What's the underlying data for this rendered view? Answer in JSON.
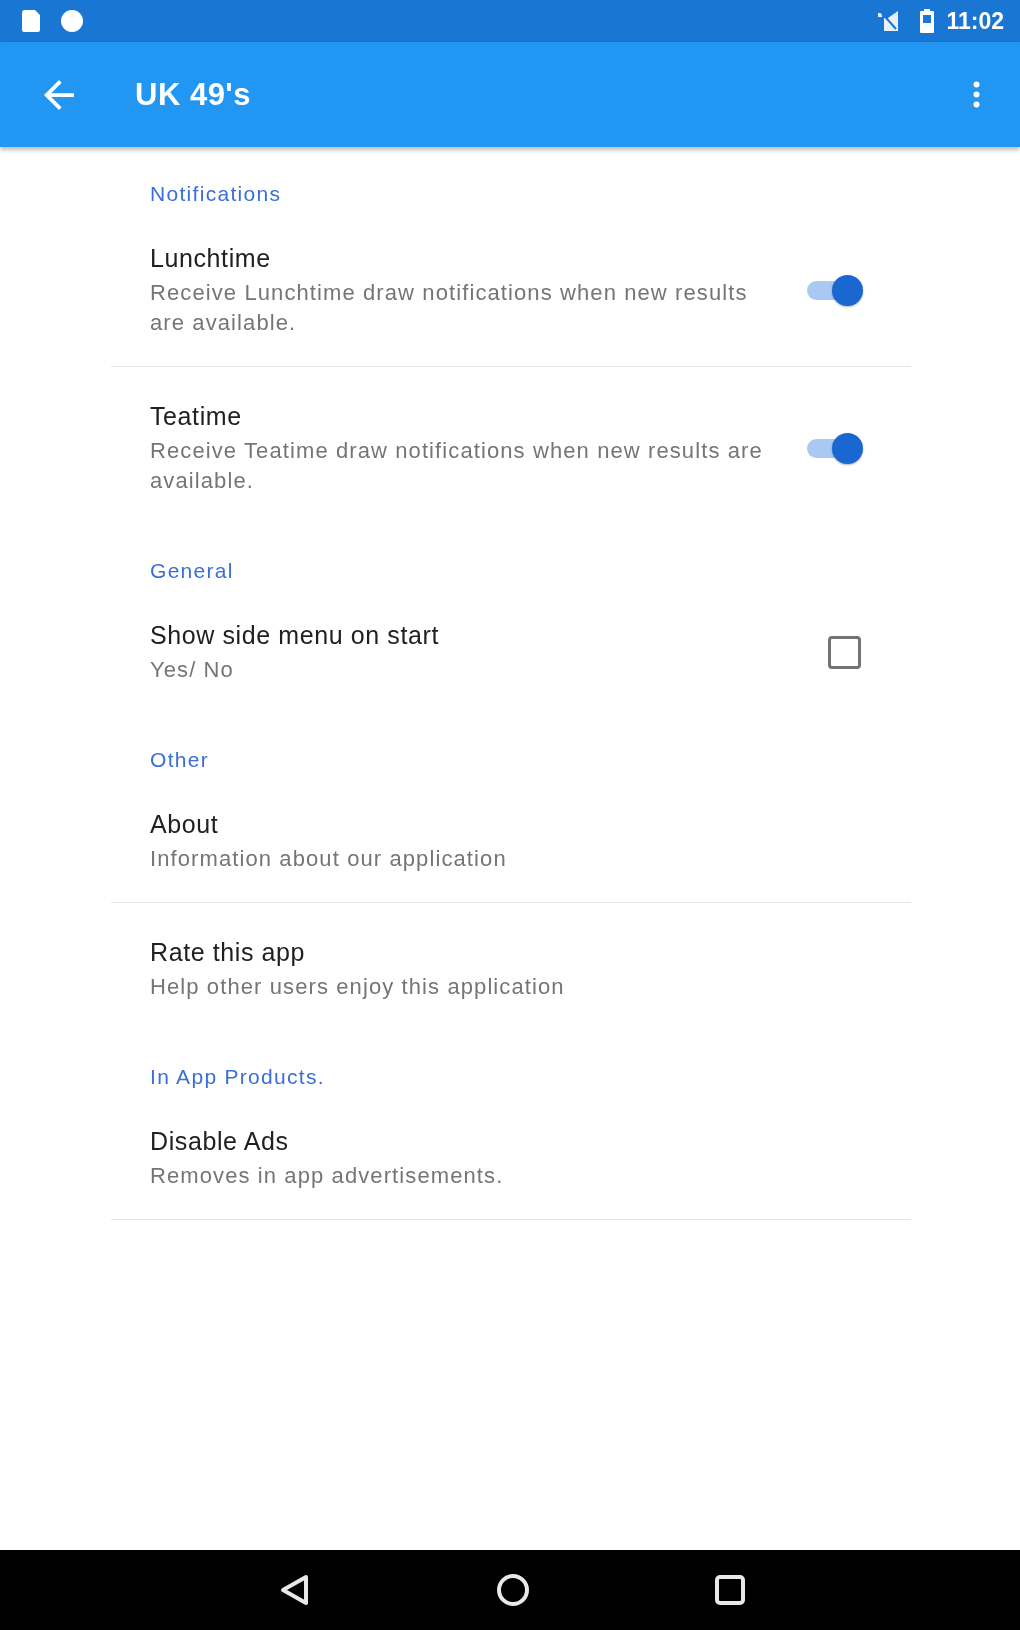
{
  "status_bar": {
    "time": "11:02"
  },
  "app_bar": {
    "title": "UK 49's"
  },
  "sections": [
    {
      "header": "Notifications",
      "items": [
        {
          "kind": "switch",
          "title": "Lunchtime",
          "summary": "Receive Lunchtime draw notifications when new results are available.",
          "on": true
        },
        {
          "kind": "switch",
          "title": "Teatime",
          "summary": "Receive Teatime draw notifications when new results are available.",
          "on": true
        }
      ]
    },
    {
      "header": "General",
      "items": [
        {
          "kind": "checkbox",
          "title": "Show side menu on start",
          "summary": "Yes/ No",
          "checked": false
        }
      ]
    },
    {
      "header": "Other",
      "items": [
        {
          "kind": "plain",
          "title": "About",
          "summary": "Information about our application"
        },
        {
          "kind": "plain",
          "title": "Rate this app",
          "summary": "Help other users enjoy this application"
        }
      ]
    },
    {
      "header": "In App Products.",
      "items": [
        {
          "kind": "plain",
          "title": "Disable Ads",
          "summary": "Removes in app advertisements."
        }
      ]
    }
  ]
}
